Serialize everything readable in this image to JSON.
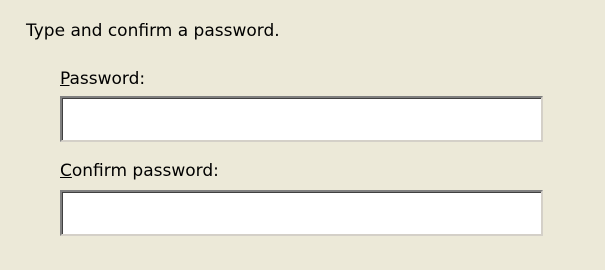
{
  "instruction": "Type and confirm a password.",
  "password": {
    "label_mnemonic": "P",
    "label_rest": "assword:",
    "value": ""
  },
  "confirm_password": {
    "label_mnemonic": "C",
    "label_rest": "onfirm password:",
    "value": ""
  },
  "colors": {
    "dialog_background": "#ece9d8",
    "field_background": "#ffffff",
    "field_border_dark": "#808080"
  }
}
